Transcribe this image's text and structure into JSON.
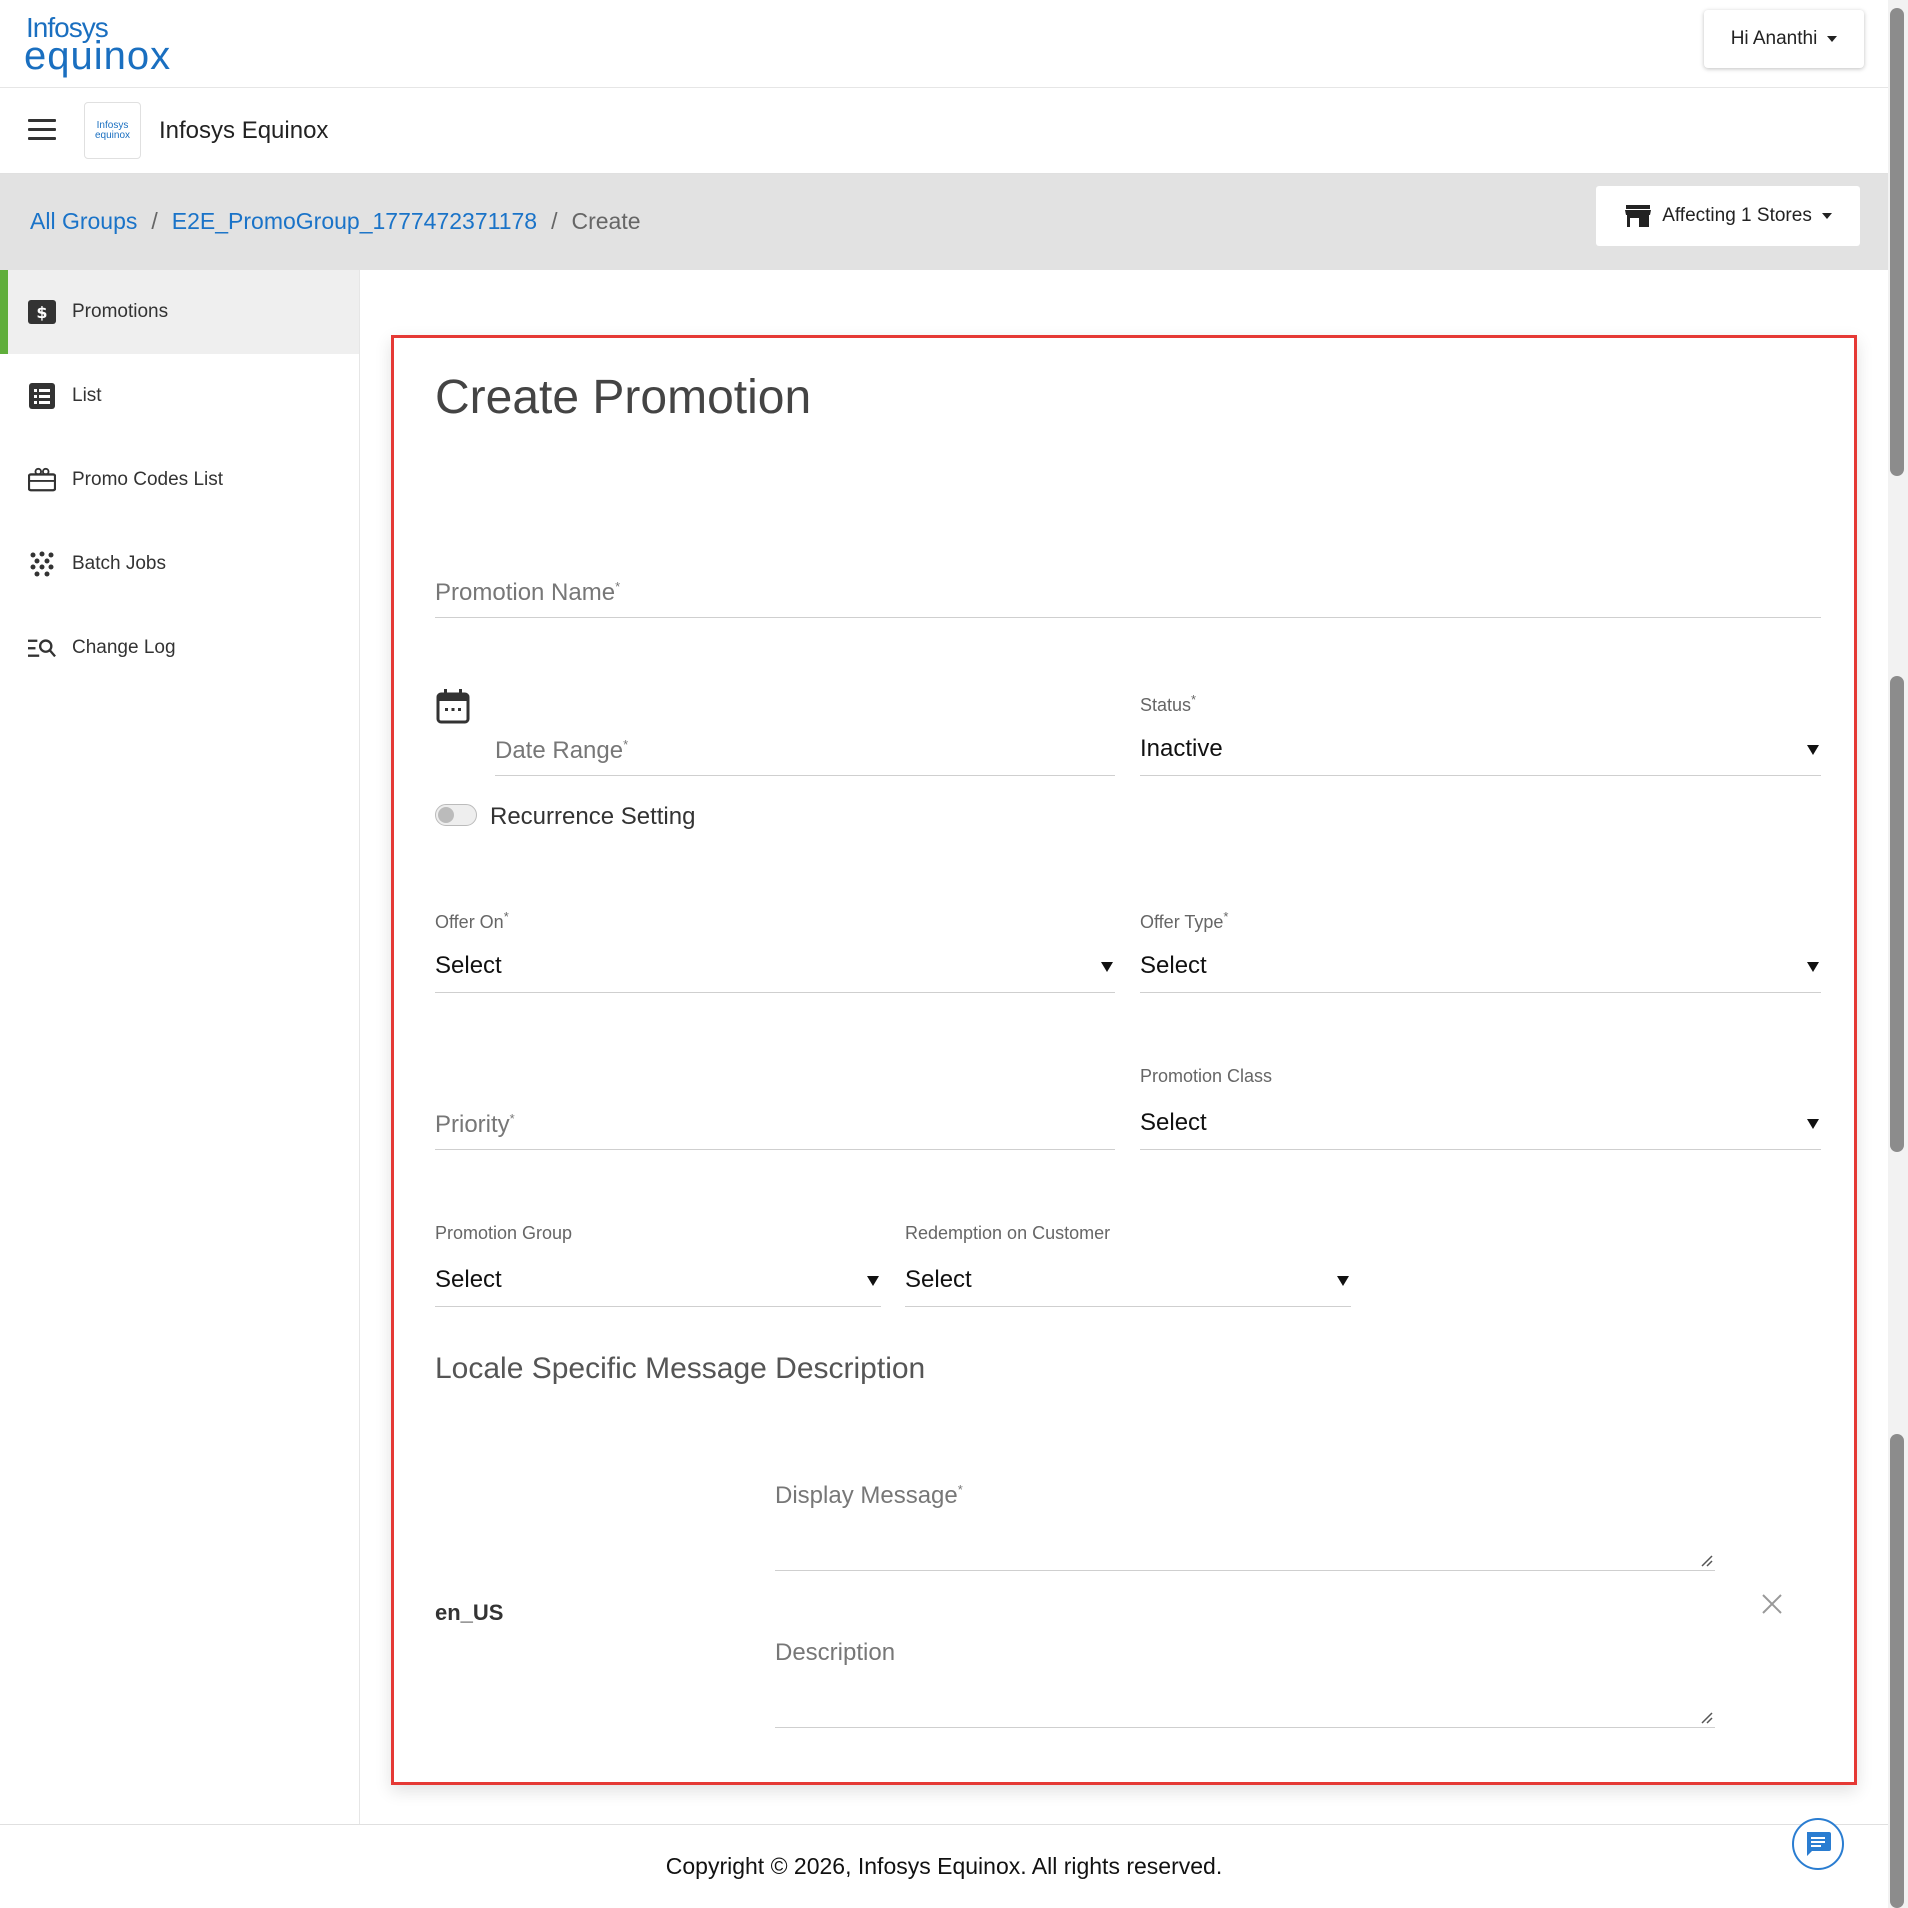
{
  "brand": {
    "line1": "Infosys",
    "line2": "equinox"
  },
  "user_menu": {
    "label": "Hi Ananthi"
  },
  "app": {
    "title": "Infosys Equinox",
    "icon_text1": "Infosys",
    "icon_text2": "equinox"
  },
  "breadcrumb": {
    "items": [
      "All Groups",
      "E2E_PromoGroup_1777472371178",
      "Create"
    ],
    "separator": "/"
  },
  "stores_button": {
    "label": "Affecting 1 Stores"
  },
  "sidebar": {
    "items": [
      {
        "label": "Promotions",
        "icon": "dollar-icon",
        "active": true
      },
      {
        "label": "List",
        "icon": "list-icon"
      },
      {
        "label": "Promo Codes List",
        "icon": "ticket-icon"
      },
      {
        "label": "Batch Jobs",
        "icon": "dots-grid-icon"
      },
      {
        "label": "Change Log",
        "icon": "search-list-icon"
      }
    ]
  },
  "form": {
    "title": "Create Promotion",
    "promotion_name": {
      "placeholder": "Promotion Name",
      "required": "*"
    },
    "date_range": {
      "placeholder": "Date Range",
      "required": "*"
    },
    "status": {
      "label": "Status",
      "required": "*",
      "value": "Inactive"
    },
    "recurrence": {
      "label": "Recurrence Setting",
      "enabled": false
    },
    "offer_on": {
      "label": "Offer On",
      "required": "*",
      "value": "Select"
    },
    "offer_type": {
      "label": "Offer Type",
      "required": "*",
      "value": "Select"
    },
    "priority": {
      "placeholder": "Priority",
      "required": "*"
    },
    "promotion_class": {
      "label": "Promotion Class",
      "value": "Select"
    },
    "promotion_group": {
      "label": "Promotion Group",
      "value": "Select"
    },
    "redemption": {
      "label": "Redemption on Customer",
      "value": "Select"
    },
    "locale_section": {
      "title": "Locale Specific Message Description",
      "locale": "en_US",
      "display_message": {
        "placeholder": "Display Message",
        "required": "*"
      },
      "description": {
        "placeholder": "Description"
      }
    }
  },
  "footer": {
    "text": "Copyright © 2026, Infosys Equinox. All rights reserved."
  },
  "colors": {
    "accent": "#1a73c8",
    "active_bar": "#5fae3b",
    "highlight_border": "#e53935"
  }
}
